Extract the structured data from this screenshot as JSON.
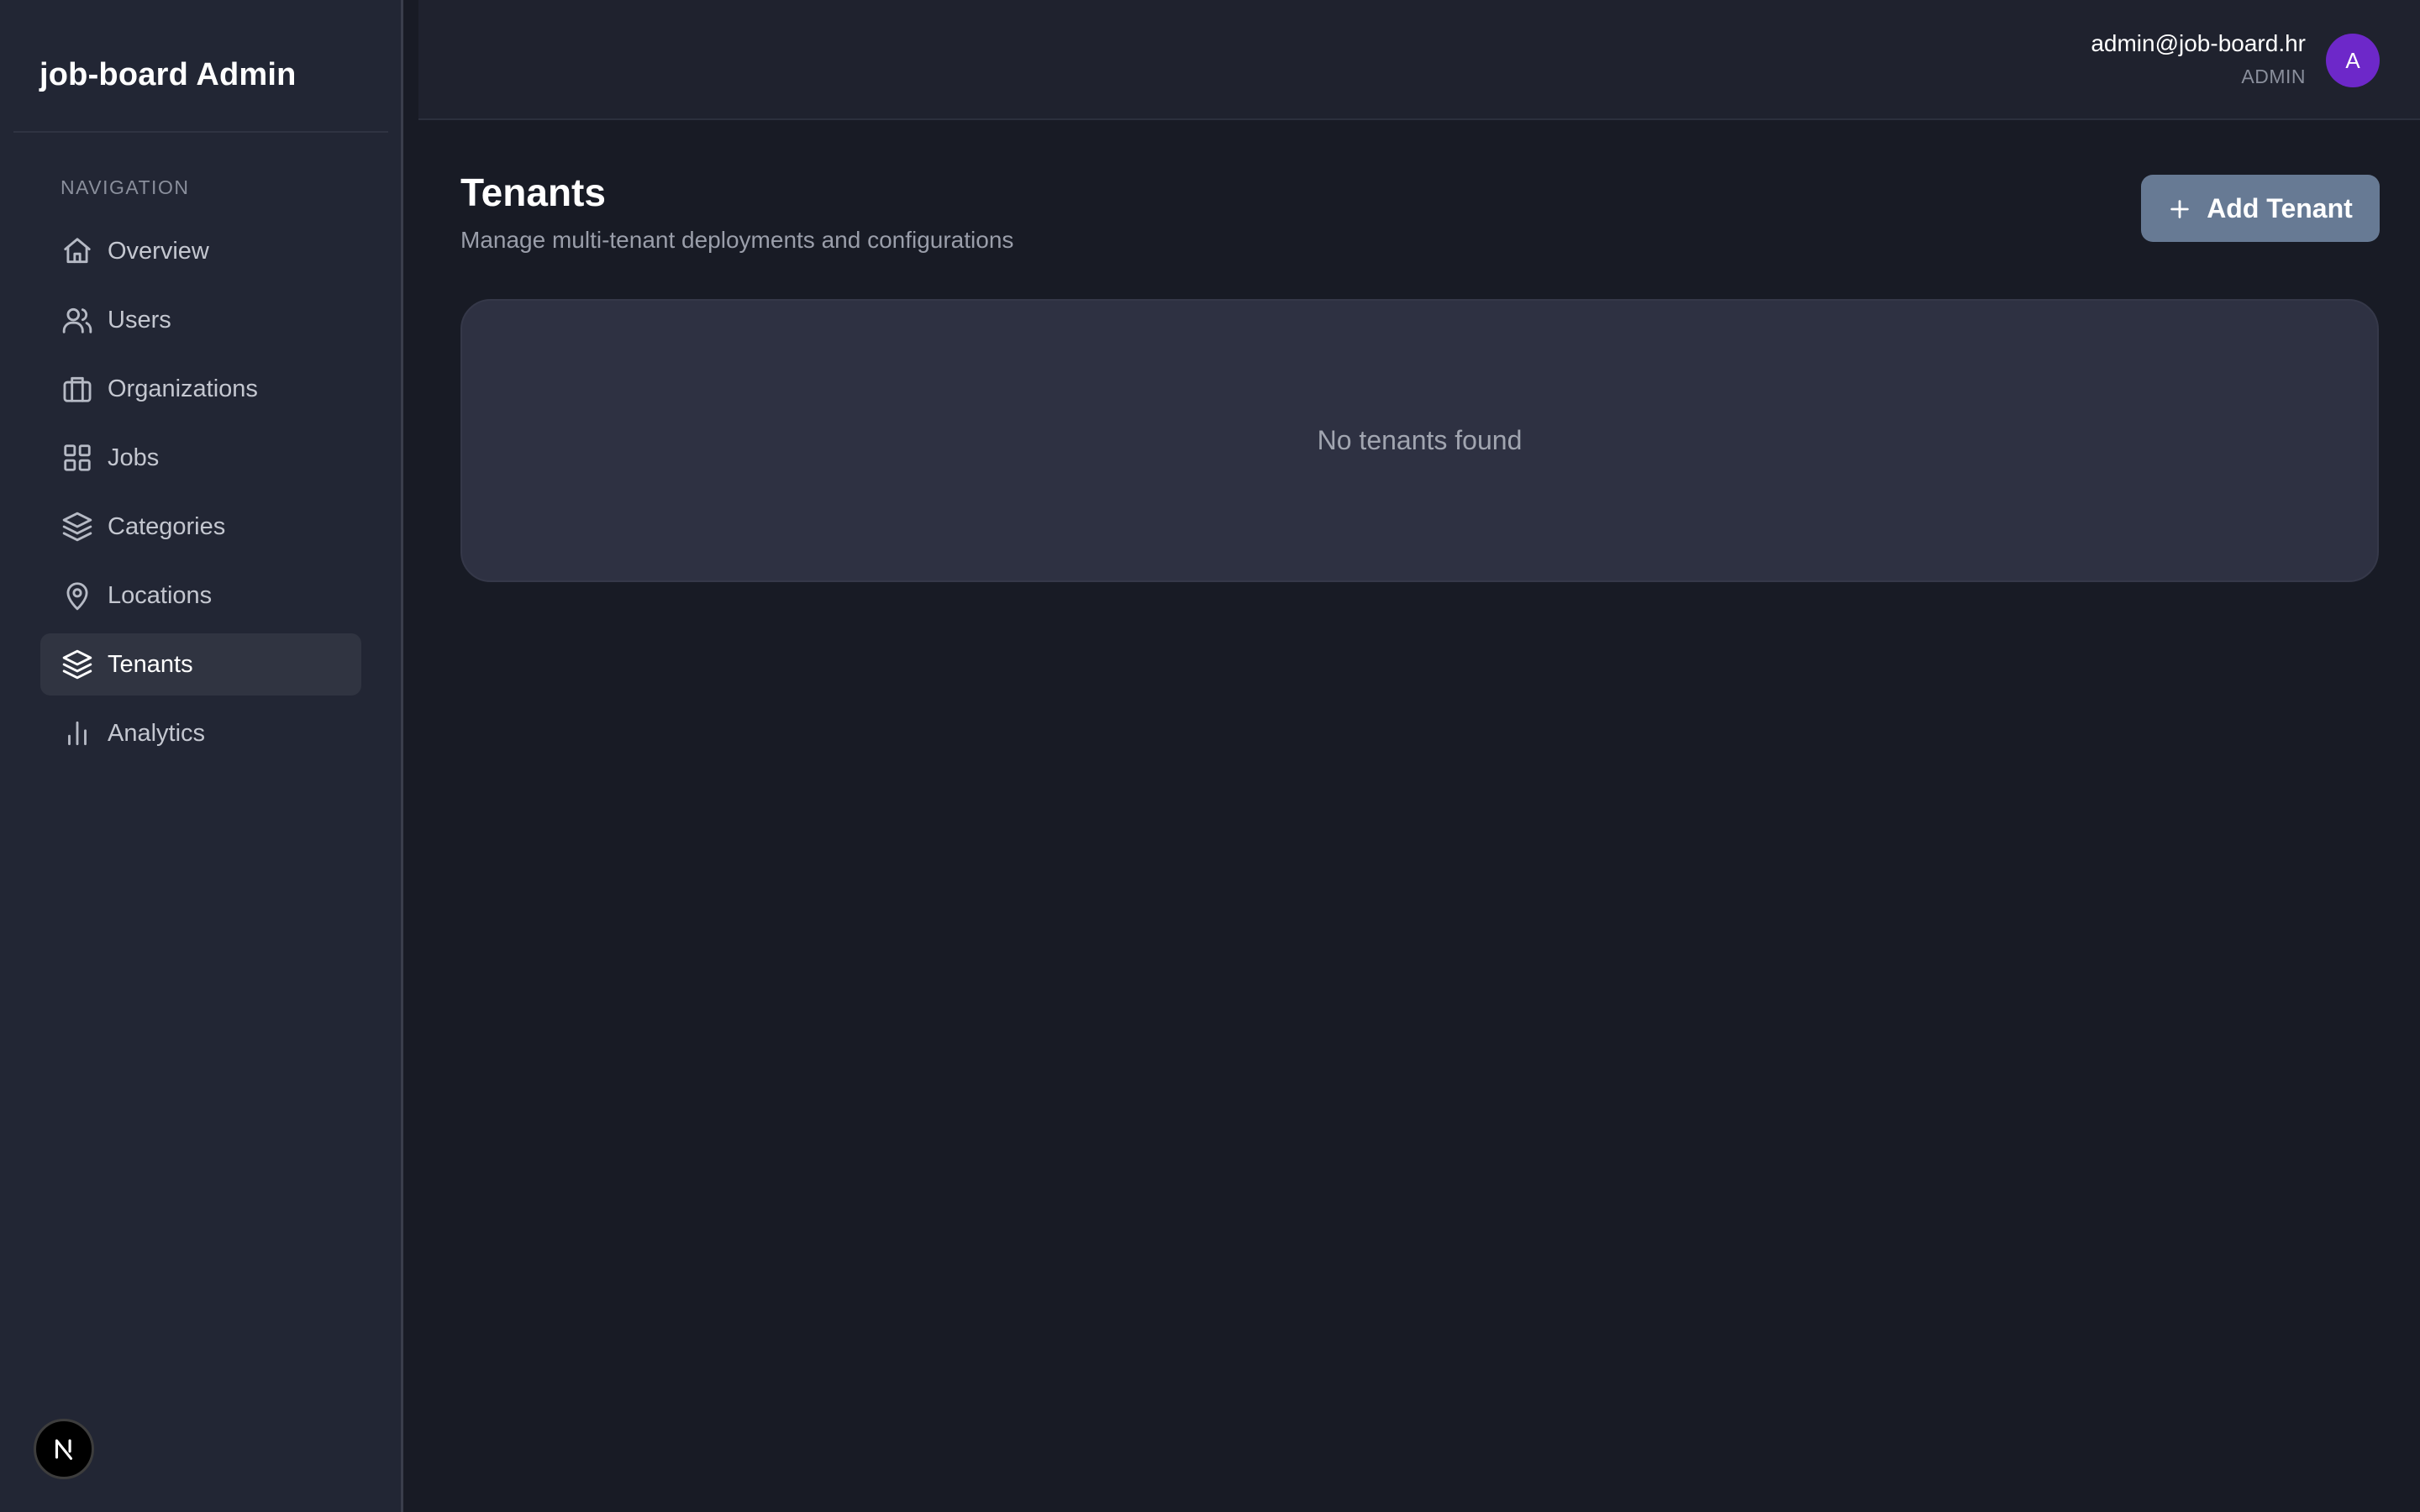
{
  "sidebar": {
    "brand": "job-board Admin",
    "nav_heading": "NAVIGATION",
    "items": [
      {
        "label": "Overview",
        "icon": "home-icon"
      },
      {
        "label": "Users",
        "icon": "users-icon"
      },
      {
        "label": "Organizations",
        "icon": "briefcase-icon"
      },
      {
        "label": "Jobs",
        "icon": "grid-icon"
      },
      {
        "label": "Categories",
        "icon": "layers-icon"
      },
      {
        "label": "Locations",
        "icon": "map-pin-icon"
      },
      {
        "label": "Tenants",
        "icon": "layers-icon",
        "active": true
      },
      {
        "label": "Analytics",
        "icon": "bar-chart-icon"
      }
    ]
  },
  "header": {
    "user_email": "admin@job-board.hr",
    "user_role": "ADMIN",
    "avatar_initial": "A"
  },
  "main": {
    "title": "Tenants",
    "subtitle": "Manage multi-tenant deployments and configurations",
    "add_button_label": "Add Tenant",
    "empty_message": "No tenants found"
  },
  "colors": {
    "background": "#181b25",
    "sidebar": "#222634",
    "active_item": "#303441",
    "add_button": "#677a94",
    "avatar": "#6d28c9",
    "card": "#2e3142"
  }
}
